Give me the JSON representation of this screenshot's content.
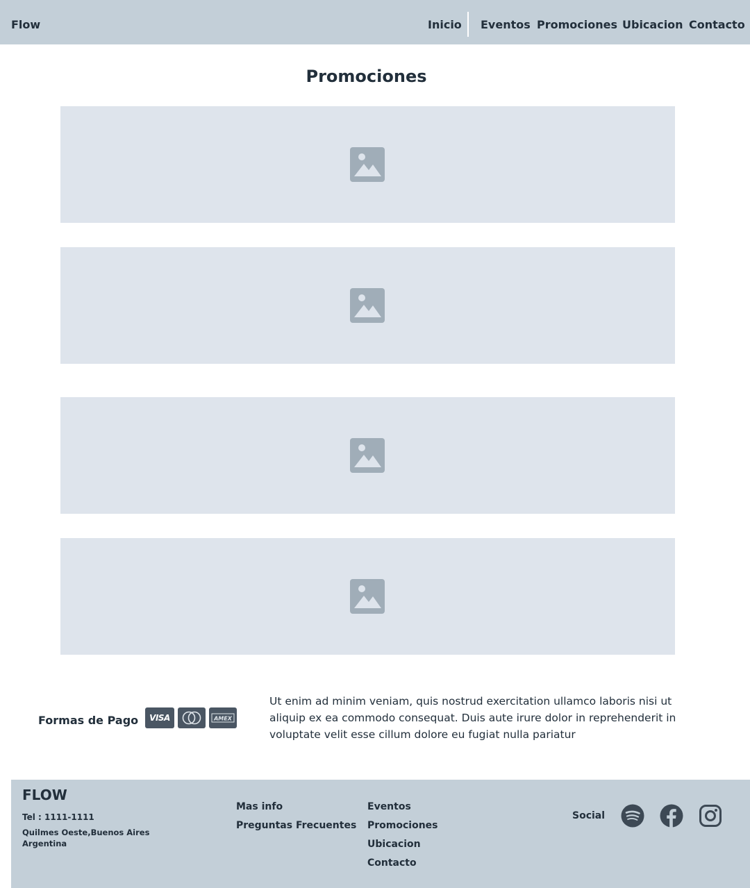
{
  "header": {
    "brand": "Flow",
    "nav": [
      "Inicio",
      "Eventos",
      "Promociones",
      "Ubicacion",
      "Contacto"
    ]
  },
  "main": {
    "title": "Promociones",
    "promo_image_icon": "image-placeholder-icon"
  },
  "payment": {
    "label": "Formas de Pago",
    "cards": [
      "VISA",
      "mastercard-icon",
      "amex-icon"
    ],
    "amex_text": "AMEX",
    "description": "Ut enim ad minim veniam, quis nostrud exercitation ullamco laboris nisi ut aliquip ex ea commodo consequat. Duis aute irure dolor in reprehenderit in voluptate velit esse cillum dolore eu fugiat nulla pariatur"
  },
  "footer": {
    "brand": "FLOW",
    "phone": "Tel : 1111-1111",
    "address": "Quilmes Oeste,Buenos Aires Argentina",
    "col1": [
      "Mas info",
      "Preguntas Frecuentes"
    ],
    "col2": [
      "Eventos",
      "Promociones",
      "Ubicacion",
      "Contacto"
    ],
    "social_label": "Social",
    "social_icons": [
      "spotify-icon",
      "facebook-icon",
      "instagram-icon"
    ]
  },
  "colors": {
    "navbar_bg": "#c3cfd8",
    "promo_bg": "#dee4ec",
    "icon_gray": "#a0adb8",
    "text_dark": "#222f3b",
    "card_bg": "#4a5663"
  }
}
